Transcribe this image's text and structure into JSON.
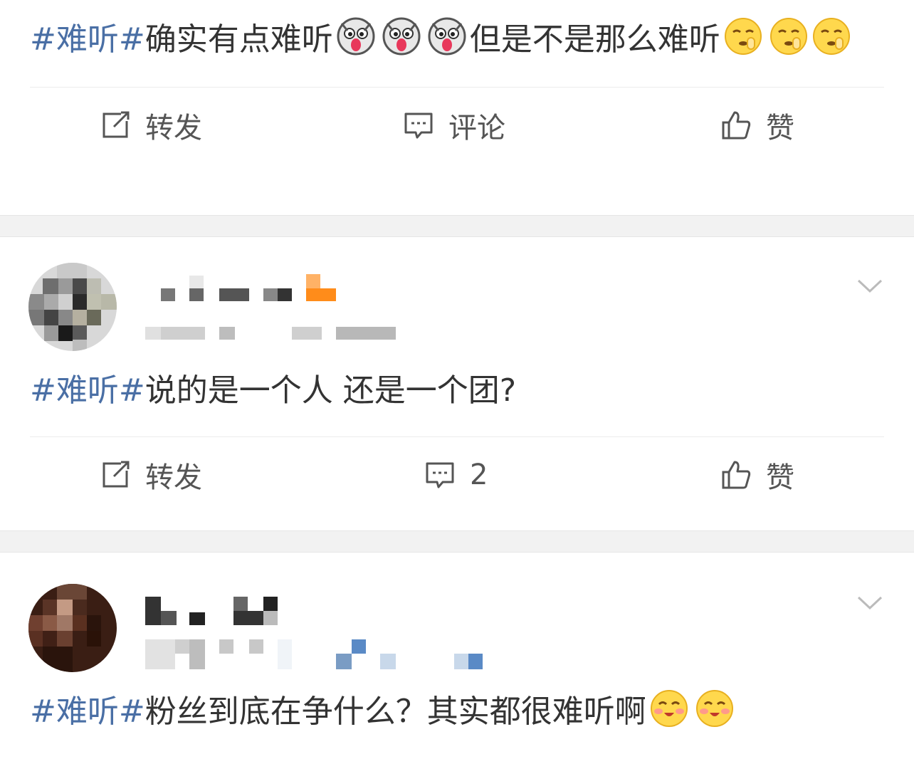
{
  "posts": [
    {
      "text_tag": "#难听#",
      "text_a": "确实有点难听",
      "emojis_a": [
        "husky-face",
        "husky-face",
        "husky-face"
      ],
      "text_b": "但是不是那么难听",
      "emojis_b": [
        "shush-face",
        "shush-face",
        "shush-face"
      ],
      "actions": {
        "repost": "转发",
        "comment": "评论",
        "like": "赞"
      }
    },
    {
      "text_tag": "#难听#",
      "text": "说的是一个人 还是一个团?",
      "actions": {
        "repost": "转发",
        "comment": "2",
        "like": "赞"
      }
    },
    {
      "text_tag": "#难听#",
      "text": "粉丝到底在争什么？其实都很难听啊",
      "emojis": [
        "blush-face",
        "blush-face"
      ]
    }
  ],
  "colors": {
    "hashtag": "#4a6fa5",
    "separator": "#f2f2f2",
    "action_text": "#555555"
  }
}
